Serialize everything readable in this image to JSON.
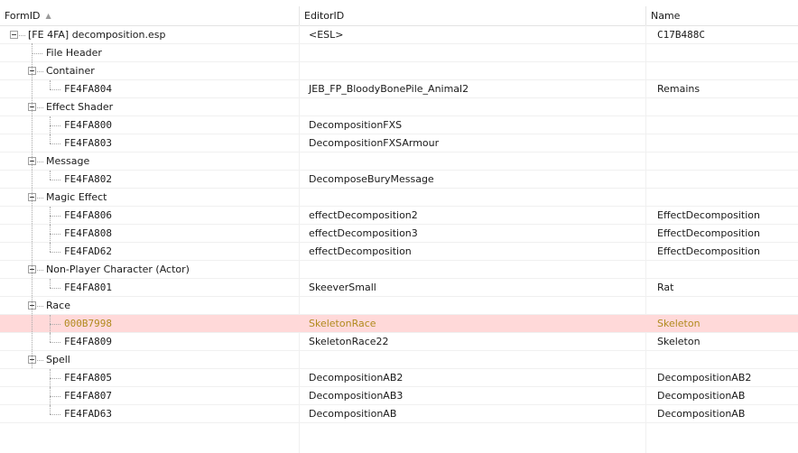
{
  "columns": {
    "formid": "FormID",
    "editorid": "EditorID",
    "name": "Name"
  },
  "file": {
    "formid": "[FE 4FA] decomposition.esp",
    "editorid": "<ESL>",
    "name": "C17B488C"
  },
  "file_header": "File Header",
  "groups": {
    "container": {
      "label": "Container",
      "records": [
        {
          "formid": "FE4FA804",
          "editorid": "JEB_FP_BloodyBonePile_Animal2",
          "name": "Remains"
        }
      ]
    },
    "effect_shader": {
      "label": "Effect Shader",
      "records": [
        {
          "formid": "FE4FA800",
          "editorid": "DecompositionFXS",
          "name": ""
        },
        {
          "formid": "FE4FA803",
          "editorid": "DecompositionFXSArmour",
          "name": ""
        }
      ]
    },
    "message": {
      "label": "Message",
      "records": [
        {
          "formid": "FE4FA802",
          "editorid": "DecomposeBuryMessage",
          "name": ""
        }
      ]
    },
    "magic_effect": {
      "label": "Magic Effect",
      "records": [
        {
          "formid": "FE4FA806",
          "editorid": "effectDecomposition2",
          "name": "EffectDecomposition"
        },
        {
          "formid": "FE4FA808",
          "editorid": "effectDecomposition3",
          "name": "EffectDecomposition"
        },
        {
          "formid": "FE4FAD62",
          "editorid": "effectDecomposition",
          "name": "EffectDecomposition"
        }
      ]
    },
    "npc": {
      "label": "Non-Player Character (Actor)",
      "records": [
        {
          "formid": "FE4FA801",
          "editorid": "SkeeverSmall",
          "name": "Rat"
        }
      ]
    },
    "race": {
      "label": "Race",
      "records": [
        {
          "formid": "000B7998",
          "editorid": "SkeletonRace",
          "name": "Skeleton"
        },
        {
          "formid": "FE4FA809",
          "editorid": "SkeletonRace22",
          "name": "Skeleton"
        }
      ]
    },
    "spell": {
      "label": "Spell",
      "records": [
        {
          "formid": "FE4FA805",
          "editorid": "DecompositionAB2",
          "name": "DecompositionAB2"
        },
        {
          "formid": "FE4FA807",
          "editorid": "DecompositionAB3",
          "name": "DecompositionAB"
        },
        {
          "formid": "FE4FAD63",
          "editorid": "DecompositionAB",
          "name": "DecompositionAB"
        }
      ]
    }
  },
  "colors": {
    "selected_row_bg": "#ffd9d9",
    "selected_text": "#b08a1e"
  }
}
